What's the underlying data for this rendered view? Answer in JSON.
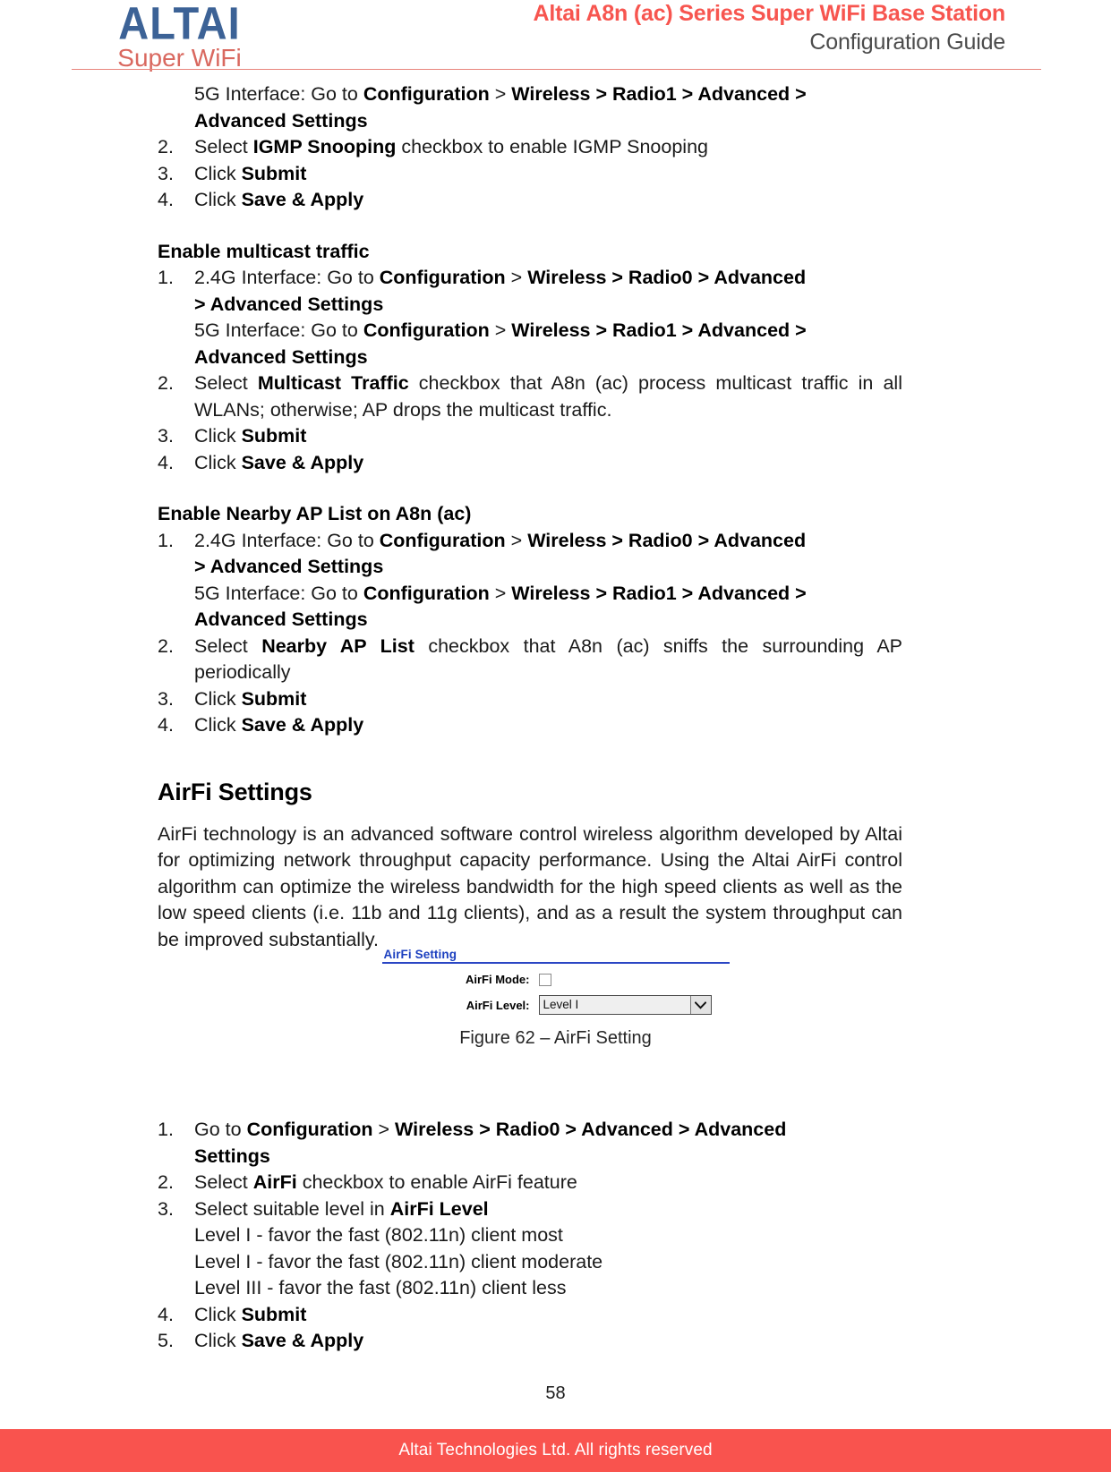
{
  "header": {
    "logo_main": "ALTAI",
    "logo_sub": "Super WiFi",
    "title_main": "Altai A8n (ac) Series Super WiFi Base Station",
    "title_sub": "Configuration Guide",
    "accent_color": "#F7554F",
    "logo_blue": "#3C6296",
    "logo_red": "#D9685F"
  },
  "igmp_section": {
    "item1_cont_a": "5G Interface: Go to ",
    "item1_cont_b": "Configuration",
    "item1_cont_c": " > ",
    "item1_cont_d": "Wireless > Radio1 > Advanced >",
    "item1_cont_e": "Advanced Settings",
    "item2_num": "2.",
    "item2_a": "Select ",
    "item2_b": "IGMP Snooping",
    "item2_c": " checkbox to enable IGMP Snooping",
    "item3_num": "3.",
    "item3_a": "Click ",
    "item3_b": "Submit",
    "item4_num": "4.",
    "item4_a": "Click ",
    "item4_b": "Save & Apply"
  },
  "multicast_section": {
    "heading": "Enable multicast traffic",
    "item1_num": "1.",
    "item1_a": "2.4G Interface: Go to ",
    "item1_b": "Configuration",
    "item1_c": " > ",
    "item1_d": "Wireless > Radio0 > Advanced",
    "item1_e": "> Advanced Settings",
    "item1_f": "5G Interface: Go to ",
    "item1_g": "Configuration",
    "item1_h": " > ",
    "item1_i": "Wireless > Radio1 > Advanced >",
    "item1_j": "Advanced Settings",
    "item2_num": "2.",
    "item2_a": "Select ",
    "item2_b": "Multicast Traffic",
    "item2_c": " checkbox that A8n (ac) process multicast traffic in all WLANs; otherwise; AP drops the multicast traffic.",
    "item3_num": "3.",
    "item3_a": "Click ",
    "item3_b": "Submit",
    "item4_num": "4.",
    "item4_a": "Click ",
    "item4_b": "Save & Apply"
  },
  "nearby_section": {
    "heading": "Enable Nearby AP List on A8n (ac)",
    "item1_num": "1.",
    "item1_a": "2.4G Interface: Go to ",
    "item1_b": "Configuration",
    "item1_c": " > ",
    "item1_d": "Wireless > Radio0 > Advanced",
    "item1_e": "> Advanced Settings",
    "item1_f": "5G Interface: Go to ",
    "item1_g": "Configuration",
    "item1_h": " > ",
    "item1_i": "Wireless > Radio1 > Advanced >",
    "item1_j": "Advanced Settings",
    "item2_num": "2.",
    "item2_a": "Select ",
    "item2_b": "Nearby AP List",
    "item2_c": " checkbox that A8n (ac) sniffs the surrounding AP periodically",
    "item3_num": "3.",
    "item3_a": "Click ",
    "item3_b": "Submit",
    "item4_num": "4.",
    "item4_a": "Click ",
    "item4_b": "Save & Apply"
  },
  "airfi_section": {
    "heading": "AirFi Settings",
    "paragraph": "AirFi technology is an advanced software control wireless algorithm developed by Altai for optimizing network throughput capacity performance. Using the Altai AirFi control algorithm can optimize the wireless bandwidth for the high speed clients as well as the low speed clients (i.e. 11b and 11g clients), and as a result the system throughput can be improved substantially.",
    "item1_num": "1.",
    "item1_a": "Go to ",
    "item1_b": "Configuration",
    "item1_c": " > ",
    "item1_d": "Wireless > Radio0 > Advanced > Advanced",
    "item1_e": "Settings",
    "item2_num": "2.",
    "item2_a": "Select ",
    "item2_b": "AirFi",
    "item2_c": " checkbox to enable AirFi feature",
    "item3_num": "3.",
    "item3_a": " Select suitable level in ",
    "item3_b": "AirFi Level",
    "level1": "Level I - favor the fast (802.11n) client most",
    "level2": "Level I - favor the fast (802.11n) client moderate",
    "level3": "Level III - favor the fast (802.11n) client less",
    "item4_num": "4.",
    "item4_a": "Click ",
    "item4_b": "Submit",
    "item5_num": "5.",
    "item5_a": "Click ",
    "item5_b": "Save & Apply"
  },
  "figure": {
    "panel_title": "AirFi Setting",
    "mode_label": "AirFi Mode:",
    "mode_checked": false,
    "level_label": "AirFi Level:",
    "level_value": "Level I",
    "caption": "Figure 62 – AirFi Setting",
    "panel_accent": "#2A46C4"
  },
  "footer": {
    "page_number": "58",
    "copyright": "Altai Technologies Ltd. All rights reserved",
    "bar_color": "#F9534E"
  }
}
